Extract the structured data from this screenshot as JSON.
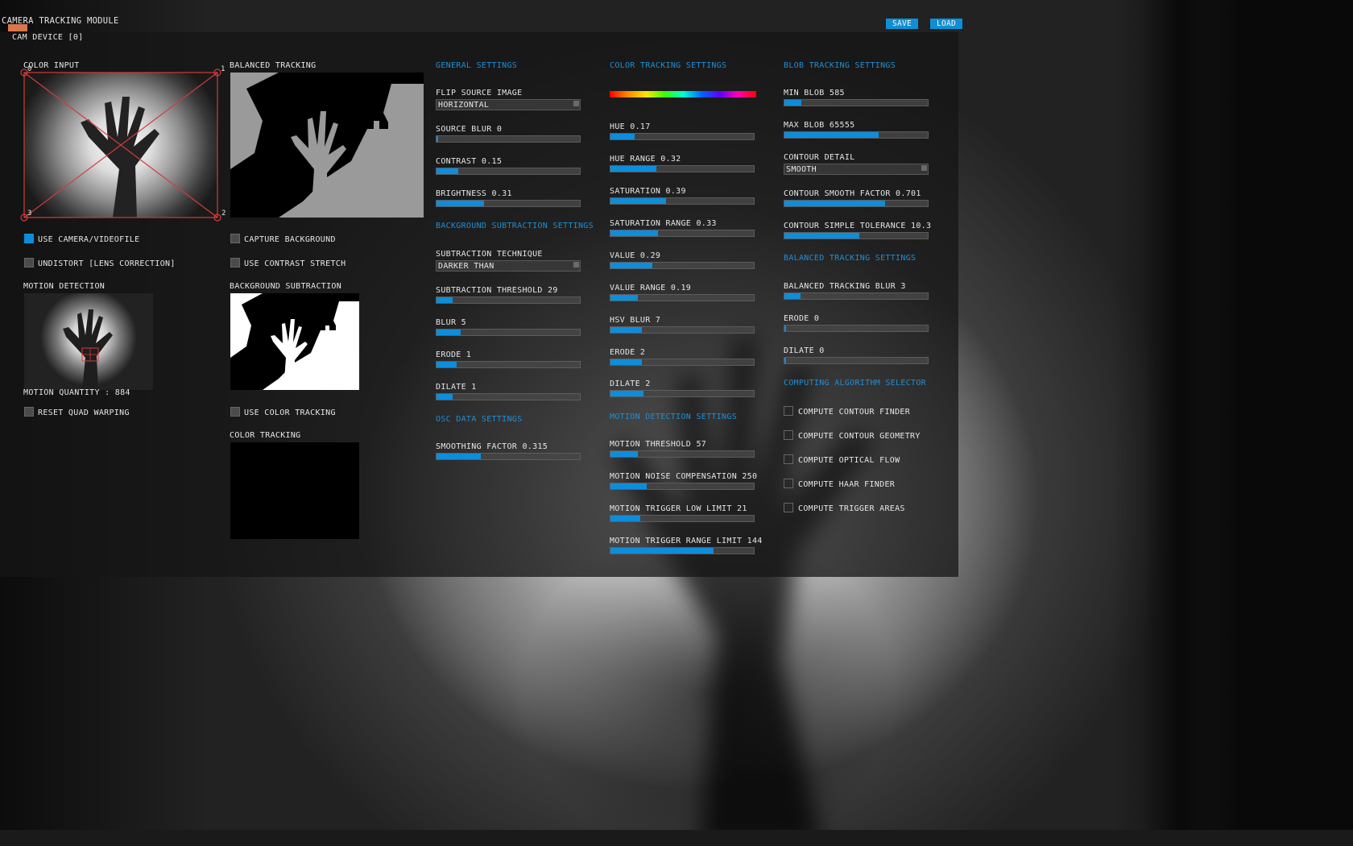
{
  "window": {
    "title": "CAMERA TRACKING MODULE",
    "device": "CAM DEVICE [0]"
  },
  "toolbar": {
    "save_label": "SAVE",
    "load_label": "LOAD"
  },
  "panels": {
    "color_input": {
      "title": "COLOR INPUT",
      "corner_labels": [
        "0",
        "1",
        "2",
        "3"
      ]
    },
    "balanced_tracking": {
      "title": "BALANCED TRACKING"
    },
    "motion_detection": {
      "title": "MOTION DETECTION",
      "quantity": "MOTION QUANTITY : 884"
    },
    "background_subtraction": {
      "title": "BACKGROUND SUBTRACTION"
    },
    "color_tracking": {
      "title": "COLOR TRACKING"
    }
  },
  "checkboxes": {
    "use_camera": {
      "label": "USE CAMERA/VIDEOFILE",
      "checked": true
    },
    "undistort": {
      "label": "UNDISTORT [LENS CORRECTION]",
      "checked": false
    },
    "reset_quad": {
      "label": "RESET QUAD WARPING",
      "checked": false
    },
    "capture_bg": {
      "label": "CAPTURE BACKGROUND",
      "checked": false
    },
    "contrast_stretch": {
      "label": "USE CONTRAST STRETCH",
      "checked": false
    },
    "use_color_tracking": {
      "label": "USE COLOR TRACKING",
      "checked": false
    }
  },
  "general": {
    "title": "GENERAL SETTINGS",
    "flip": {
      "label": "FLIP SOURCE IMAGE",
      "value": "HORIZONTAL"
    },
    "sliders": [
      {
        "label": "SOURCE BLUR 0",
        "fill": 0.0
      },
      {
        "label": "CONTRAST 0.15",
        "fill": 0.15
      },
      {
        "label": "BRIGHTNESS 0.31",
        "fill": 0.33
      }
    ]
  },
  "bg_subtraction": {
    "title": "BACKGROUND SUBTRACTION SETTINGS",
    "technique": {
      "label": "SUBTRACTION TECHNIQUE",
      "value": "DARKER THAN"
    },
    "sliders": [
      {
        "label": "SUBTRACTION THRESHOLD 29",
        "fill": 0.11
      },
      {
        "label": "BLUR 5",
        "fill": 0.17
      },
      {
        "label": "ERODE 1",
        "fill": 0.14
      },
      {
        "label": "DILATE 1",
        "fill": 0.11
      }
    ]
  },
  "osc": {
    "title": "OSC DATA SETTINGS",
    "sliders": [
      {
        "label": "SMOOTHING FACTOR 0.315",
        "fill": 0.31
      }
    ]
  },
  "color_tracking_settings": {
    "title": "COLOR TRACKING SETTINGS",
    "sliders": [
      {
        "label": "HUE 0.17",
        "fill": 0.17
      },
      {
        "label": "HUE RANGE 0.32",
        "fill": 0.32
      },
      {
        "label": "SATURATION 0.39",
        "fill": 0.39
      },
      {
        "label": "SATURATION RANGE 0.33",
        "fill": 0.33
      },
      {
        "label": "VALUE 0.29",
        "fill": 0.29
      },
      {
        "label": "VALUE RANGE 0.19",
        "fill": 0.19
      },
      {
        "label": "HSV BLUR 7",
        "fill": 0.22
      },
      {
        "label": "ERODE 2",
        "fill": 0.22
      },
      {
        "label": "DILATE 2",
        "fill": 0.23
      }
    ]
  },
  "motion_settings": {
    "title": "MOTION DETECTION SETTINGS",
    "sliders": [
      {
        "label": "MOTION THRESHOLD 57",
        "fill": 0.19
      },
      {
        "label": "MOTION NOISE COMPENSATION 250",
        "fill": 0.25
      },
      {
        "label": "MOTION TRIGGER LOW LIMIT 21",
        "fill": 0.21
      },
      {
        "label": "MOTION TRIGGER RANGE LIMIT 144",
        "fill": 0.72
      }
    ]
  },
  "blob_settings": {
    "title": "BLOB TRACKING SETTINGS",
    "sliders": [
      {
        "label": "MIN BLOB 585",
        "fill": 0.12
      },
      {
        "label": "MAX BLOB 65555",
        "fill": 0.66
      }
    ],
    "contour": {
      "label": "CONTOUR DETAIL",
      "value": "SMOOTH"
    },
    "sliders2": [
      {
        "label": "CONTOUR SMOOTH FACTOR 0.701",
        "fill": 0.7
      },
      {
        "label": "CONTOUR SIMPLE TOLERANCE 10.3",
        "fill": 0.52
      }
    ]
  },
  "balanced_settings": {
    "title": "BALANCED TRACKING SETTINGS",
    "sliders": [
      {
        "label": "BALANCED TRACKING BLUR 3",
        "fill": 0.11
      },
      {
        "label": "ERODE 0",
        "fill": 0.01
      },
      {
        "label": "DILATE 0",
        "fill": 0.01
      }
    ]
  },
  "algorithm": {
    "title": "COMPUTING ALGORITHM SELECTOR",
    "items": [
      {
        "label": "COMPUTE CONTOUR FINDER",
        "checked": false
      },
      {
        "label": "COMPUTE CONTOUR GEOMETRY",
        "checked": false
      },
      {
        "label": "COMPUTE OPTICAL FLOW",
        "checked": false
      },
      {
        "label": "COMPUTE HAAR FINDER",
        "checked": false
      },
      {
        "label": "COMPUTE TRIGGER AREAS",
        "checked": false
      }
    ]
  },
  "colors": {
    "accent": "#0d8ddb",
    "section": "#1f8fd6",
    "tab_marker": "#d9774a",
    "quad": "#d43b3b"
  }
}
